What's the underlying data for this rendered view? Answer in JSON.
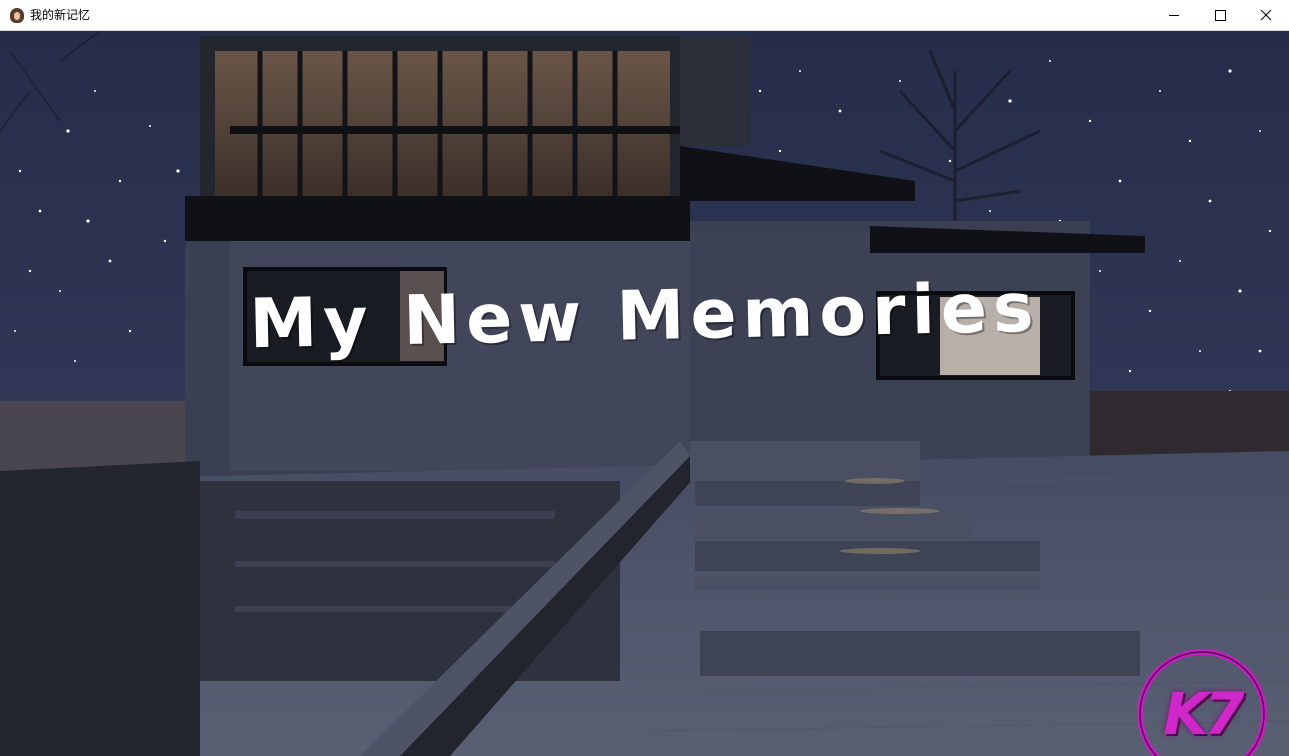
{
  "window": {
    "title": "我的新记忆",
    "controls": {
      "minimize_icon": "minimize-icon",
      "maximize_icon": "maximize-icon",
      "close_icon": "close-icon"
    }
  },
  "game": {
    "title": "My New Memories",
    "logo_text": "K7",
    "colors": {
      "sky": "#2a3354",
      "logo": "#c41fbf",
      "title_text": "#ffffff"
    }
  }
}
